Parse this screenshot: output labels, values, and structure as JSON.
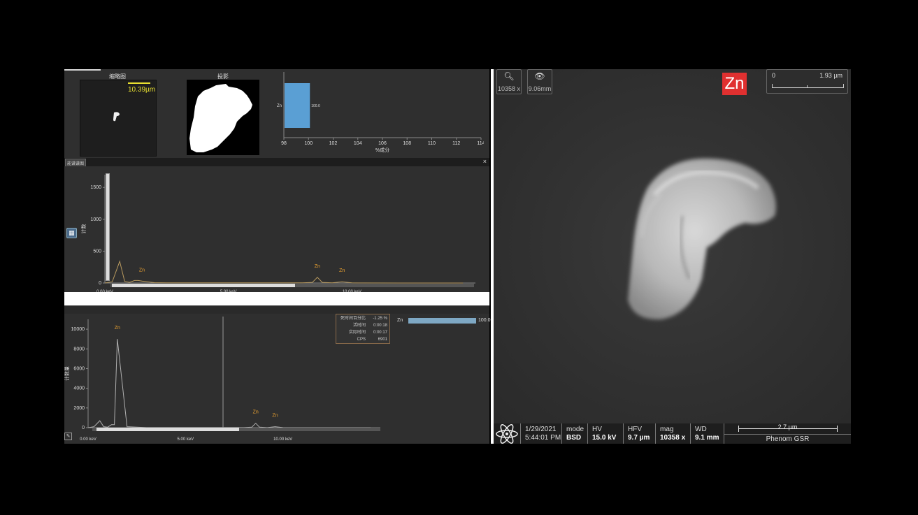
{
  "colors": {
    "accent_bar": "#5a9fd4",
    "spectrum_line": "#b89a5f",
    "element_label": "#e8a030",
    "scale_yellow": "#e8e030",
    "badge_red": "#e03030"
  },
  "top_panel": {
    "thumb_title": "缩略图",
    "thumb_scale": "10.39µm",
    "proj_title": "投影",
    "bar_chart": {
      "element": "Zn",
      "value_label": "100.0",
      "xlabel": "%成分",
      "ticks": [
        "98",
        "100",
        "102",
        "104",
        "106",
        "108",
        "110",
        "112",
        "114"
      ]
    }
  },
  "spectrum_panel": {
    "tab_label": "能谱谱图",
    "close_label": "×",
    "ylabel": "计数",
    "yticks": [
      "1500",
      "1000",
      "500",
      "0"
    ],
    "peak_labels": [
      "Zn",
      "Zn",
      "Zn"
    ],
    "xticks": [
      "0.00 keV",
      "5.00 keV",
      "10.00 keV"
    ],
    "grid_icon": "table-icon"
  },
  "bottom_panel": {
    "ylabel": "计数量",
    "yticks": [
      "10000",
      "8000",
      "6000",
      "4000",
      "2000",
      "0"
    ],
    "peak_labels": [
      "Zn",
      "Zn",
      "Zn"
    ],
    "xticks": [
      "0.00 keV",
      "5.00 keV",
      "10.00 keV"
    ],
    "stats": [
      {
        "k": "死时间百分比",
        "v": "-1.25 %"
      },
      {
        "k": "活时间",
        "v": "0:00:18"
      },
      {
        "k": "实际时间",
        "v": "0:00:17"
      },
      {
        "k": "CPS",
        "v": "6901"
      }
    ],
    "composition": {
      "element": "Zn",
      "value": "100.0",
      "fraction": 1.0
    }
  },
  "sem": {
    "zoom_value": "10358 x",
    "view_value": "9.06mm",
    "element_badge": "Zn",
    "scale_start": "0",
    "scale_end": "1.93 µm",
    "info": {
      "date": "1/29/2021",
      "time": "5:44:01 PM",
      "mode_k": "mode",
      "mode_v": "BSD",
      "hv_k": "HV",
      "hv_v": "15.0 kV",
      "hfv_k": "HFV",
      "hfv_v": "9.7 µm",
      "mag_k": "mag",
      "mag_v": "10358 x",
      "wd_k": "WD",
      "wd_v": "9.1 mm",
      "scale_label": "2.7 µm",
      "brand": "Phenom GSR"
    }
  },
  "chart_data": [
    {
      "type": "bar",
      "categories": [
        "Zn"
      ],
      "values": [
        100.0
      ],
      "xlabel": "%成分",
      "xlim": [
        98,
        114
      ]
    },
    {
      "type": "line",
      "ylabel": "计数",
      "ylim": [
        0,
        1700
      ],
      "xlim": [
        0,
        15
      ],
      "x": [
        0.0,
        0.3,
        0.6,
        0.8,
        1.0,
        1.2,
        1.35,
        1.5,
        2.0,
        2.5,
        3.0,
        5.0,
        8.0,
        8.4,
        8.6,
        8.8,
        9.2,
        9.6,
        10.0,
        12.0,
        14.5
      ],
      "y": [
        0,
        20,
        340,
        25,
        10,
        40,
        40,
        30,
        5,
        2,
        2,
        2,
        2,
        10,
        90,
        10,
        2,
        20,
        2,
        0,
        0
      ]
    },
    {
      "type": "line",
      "ylabel": "计数量",
      "ylim": [
        0,
        11000
      ],
      "xlim": [
        0,
        15
      ],
      "x": [
        0.0,
        0.3,
        0.6,
        0.8,
        1.0,
        1.2,
        1.35,
        1.5,
        2.0,
        3.0,
        5.0,
        8.0,
        8.4,
        8.6,
        8.8,
        9.2,
        9.6,
        10.0,
        12.0,
        14.5
      ],
      "y": [
        0,
        100,
        700,
        100,
        50,
        300,
        300,
        9000,
        100,
        10,
        10,
        10,
        50,
        450,
        50,
        10,
        100,
        10,
        0,
        0
      ]
    }
  ]
}
